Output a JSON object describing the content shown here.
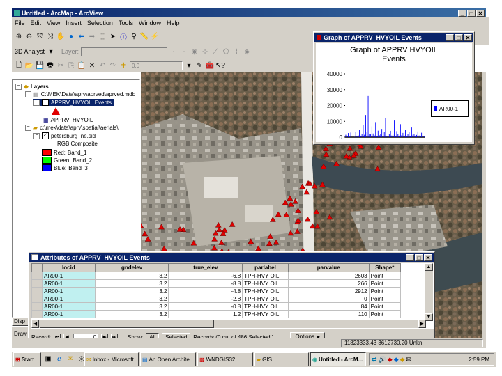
{
  "app": {
    "title": "Untitled - ArcMap - ArcView",
    "menu": [
      "File",
      "Edit",
      "View",
      "Insert",
      "Selection",
      "Tools",
      "Window",
      "Help"
    ],
    "analyst_label": "3D Analyst",
    "layer_label": "Layer:",
    "zoom_value": "0.0"
  },
  "toc": {
    "root": "Layers",
    "db_path": "C:\\MEK\\Data\\aprv\\aprved\\aprved.mdb",
    "events_layer": "APPRV_HVYOIL Events",
    "table_layer": "APPRV_HVYOIL",
    "raster_path": "c:\\mek\\data\\aprv\\spatial\\aerials\\",
    "raster_layer": "petersburg_ne.sid",
    "rgb_label": "RGB Composite",
    "bands": [
      {
        "label": "Red:",
        "band": "Band_1",
        "color": "#ff0000"
      },
      {
        "label": "Green:",
        "band": "Band_2",
        "color": "#00ff00"
      },
      {
        "label": "Blue:",
        "band": "Band_3",
        "color": "#0000ff"
      }
    ],
    "tab_display": "Disp",
    "draw_label": "Draw"
  },
  "graph_window": {
    "title": "Graph of APPRV_HVYOIL Events",
    "chart_title_line1": "Graph of APPRV HVYOIL",
    "chart_title_line2": "Events"
  },
  "chart_data": {
    "type": "bar",
    "title": "Graph of APPRV HVYOIL Events",
    "yticks": [
      0,
      10000,
      20000,
      30000,
      40000
    ],
    "ylim": [
      0,
      40000
    ],
    "series": [
      {
        "name": "AR00-1",
        "color": "#0000ff"
      }
    ],
    "values": [
      1500,
      800,
      2603,
      266,
      2912,
      0,
      84,
      110,
      3200,
      600,
      1200,
      4500,
      900,
      2100,
      7800,
      1500,
      14000,
      3500,
      26000,
      2200,
      1800,
      6800,
      2300,
      1100,
      9500,
      800,
      4100,
      1200,
      2000,
      5200,
      900,
      3100,
      12000,
      700,
      2500,
      1800,
      4000,
      1000,
      1600,
      10500,
      600,
      3800,
      2100,
      900,
      8200,
      1300,
      2700,
      1100,
      4600,
      700,
      1900,
      3300,
      800,
      6100,
      1500,
      2200,
      900,
      1400,
      3600,
      1000,
      700,
      2800,
      1200,
      500
    ]
  },
  "attributes": {
    "title": "Attributes of APPRV_HVYOIL Events",
    "columns": [
      "locid",
      "gndelev",
      "true_elev",
      "parlabel",
      "parvalue",
      "Shape*"
    ],
    "rows": [
      [
        "AR00-1",
        "3.2",
        "-6.8",
        "TPH-HVY OIL",
        "2603",
        "Point"
      ],
      [
        "AR00-1",
        "3.2",
        "-8.8",
        "TPH-HVY OIL",
        "266",
        "Point"
      ],
      [
        "AR00-1",
        "3.2",
        "-4.8",
        "TPH-HVY OIL",
        "2912",
        "Point"
      ],
      [
        "AR00-1",
        "3.2",
        "-2.8",
        "TPH-HVY OIL",
        "0",
        "Point"
      ],
      [
        "AR00-1",
        "3.2",
        "-0.8",
        "TPH-HVY OIL",
        "84",
        "Point"
      ],
      [
        "AR00-1",
        "3.2",
        "1.2",
        "TPH-HVY OIL",
        "110",
        "Point"
      ]
    ],
    "record_label": "Record:",
    "record_value": "0",
    "show_label": "Show:",
    "all_label": "All",
    "selected_label": "Selected",
    "records_info": "Records (0 out of 486 Selected.)",
    "options_label": "Options"
  },
  "status": {
    "coords": "11823333.43  3612730.20 Unkn"
  },
  "taskbar": {
    "start": "Start",
    "items": [
      "Inbox - Microsoft...",
      "An Open Archite...",
      "WNDGIS32",
      "GIS",
      "Untitled - ArcM..."
    ],
    "clock": "2:59 PM"
  }
}
